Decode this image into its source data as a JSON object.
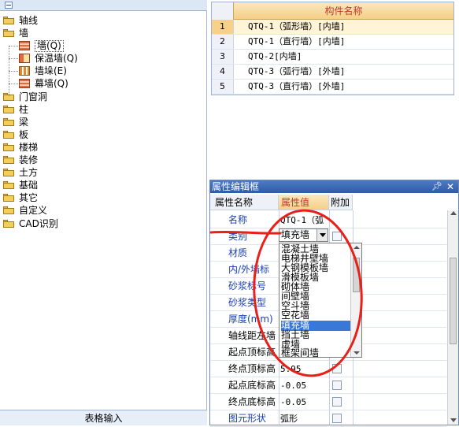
{
  "tree": {
    "items": [
      {
        "label": "轴线",
        "level": 0
      },
      {
        "label": "墙",
        "level": 0
      },
      {
        "label": "墙(Q)",
        "level": 1,
        "icon": "wall-icon"
      },
      {
        "label": "保温墙(Q)",
        "level": 1,
        "icon": "insulation-wall-icon"
      },
      {
        "label": "墙垛(E)",
        "level": 1,
        "icon": "wall-column-icon"
      },
      {
        "label": "幕墙(Q)",
        "level": 1,
        "icon": "curtain-wall-icon"
      },
      {
        "label": "门窗洞",
        "level": 0
      },
      {
        "label": "柱",
        "level": 0
      },
      {
        "label": "梁",
        "level": 0
      },
      {
        "label": "板",
        "level": 0
      },
      {
        "label": "楼梯",
        "level": 0
      },
      {
        "label": "装修",
        "level": 0
      },
      {
        "label": "土方",
        "level": 0
      },
      {
        "label": "基础",
        "level": 0
      },
      {
        "label": "其它",
        "level": 0
      },
      {
        "label": "自定义",
        "level": 0
      },
      {
        "label": "CAD识别",
        "level": 0
      }
    ],
    "bottom_button": "表格输入"
  },
  "component_table": {
    "header": "构件名称",
    "rows": [
      {
        "num": "1",
        "name": "QTQ-1（弧形墙）[内墙]"
      },
      {
        "num": "2",
        "name": "QTQ-1（直行墙）[内墙]"
      },
      {
        "num": "3",
        "name": "QTQ-2[内墙]"
      },
      {
        "num": "4",
        "name": "QTQ-3（弧行墙）[外墙]"
      },
      {
        "num": "5",
        "name": "QTQ-3（直行墙）[外墙]"
      }
    ]
  },
  "property_editor": {
    "title": "属性编辑框",
    "pin_icon": "pin-icon",
    "close_icon": "close-icon",
    "headers": {
      "name": "属性名称",
      "value": "属性值",
      "add": "附加"
    },
    "rows": [
      {
        "name": "名称",
        "value": "QTQ-1（弧",
        "checkbox": false,
        "color": "blue"
      },
      {
        "name": "类别",
        "value": "填充墙",
        "checkbox": true,
        "color": "blue"
      },
      {
        "name": "材质",
        "value": "",
        "checkbox": false,
        "color": "blue"
      },
      {
        "name": "内/外墙标",
        "value": "",
        "checkbox": false,
        "color": "blue"
      },
      {
        "name": "砂浆标号",
        "value": "",
        "checkbox": false,
        "color": "blue"
      },
      {
        "name": "砂浆类型",
        "value": "",
        "checkbox": false,
        "color": "blue"
      },
      {
        "name": "厚度(mm)",
        "value": "",
        "checkbox": false,
        "color": "blue"
      },
      {
        "name": "轴线距左墙",
        "value": "",
        "checkbox": false,
        "color": "black"
      },
      {
        "name": "起点顶标高",
        "value": "",
        "checkbox": false,
        "color": "black"
      },
      {
        "name": "终点顶标高",
        "value": "5.95",
        "checkbox": true,
        "color": "black"
      },
      {
        "name": "起点底标高",
        "value": "-0.05",
        "checkbox": true,
        "color": "black"
      },
      {
        "name": "终点底标高",
        "value": "-0.05",
        "checkbox": true,
        "color": "black"
      },
      {
        "name": "图元形状",
        "value": "弧形",
        "checkbox": true,
        "color": "blue"
      }
    ],
    "combo_value": "填充墙",
    "dropdown_options": [
      "混凝土墙",
      "电梯井壁墙",
      "大钢模板墙",
      "滑模板墙",
      "砌体墙",
      "间壁墙",
      "空斗墙",
      "空花墙",
      "填充墙",
      "挡土墙",
      "虚墙",
      "框架间墙"
    ],
    "dropdown_selected": "填充墙"
  },
  "colors": {
    "accent_header": "#f5cf86",
    "title_bar": "#2f5aa6",
    "selected": "#3a78d8",
    "annotation": "#e8201a"
  }
}
